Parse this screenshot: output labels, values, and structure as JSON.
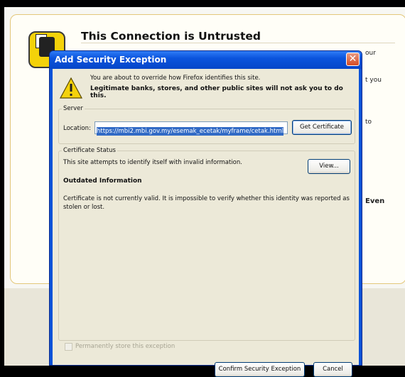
{
  "background_page": {
    "title": "This Connection is Untrusted",
    "fragments": [
      "our",
      "t you",
      "to",
      "Even"
    ]
  },
  "dialog": {
    "title": "Add Security Exception",
    "warning_line1": "You are about to override how Firefox identifies this site.",
    "warning_line2": "Legitimate banks, stores, and other public sites will not ask you to do this.",
    "server": {
      "legend": "Server",
      "location_label": "Location:",
      "location_value": "https://mbi2.mbi.gov.my/esemak_ecetak/myframe/cetak.html",
      "get_certificate": "Get Certificate"
    },
    "certificate_status": {
      "legend": "Certificate Status",
      "description": "This site attempts to identify itself with invalid information.",
      "view_button": "View...",
      "heading": "Outdated Information",
      "message": "Certificate is not currently valid. It is impossible to verify whether this identity was reported as stolen or lost."
    },
    "permanent_label": "Permanently store this exception",
    "permanent_checked": false,
    "confirm_button": "Confirm Security Exception",
    "cancel_button": "Cancel"
  },
  "colors": {
    "titlebar": "#0a53d8",
    "dialog_face": "#ece9d8",
    "close_button": "#d44b23",
    "warning_yellow": "#f4d20a"
  }
}
